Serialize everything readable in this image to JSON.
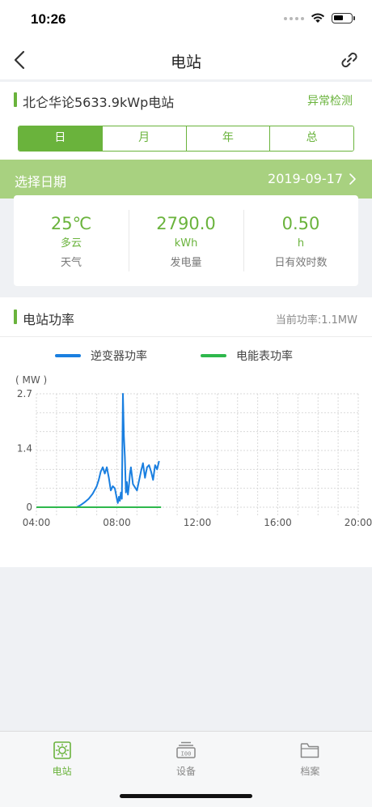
{
  "status_bar": {
    "time": "10:26"
  },
  "nav": {
    "title": "电站"
  },
  "station": {
    "name": "北仑华论5633.9kWp电站",
    "anomaly_link": "异常检测"
  },
  "period_tabs": [
    "日",
    "月",
    "年",
    "总"
  ],
  "active_period": "日",
  "date_bar": {
    "label": "选择日期",
    "value": "2019-09-17"
  },
  "stats": [
    {
      "value": "25℃",
      "unit": "多云",
      "label": "天气"
    },
    {
      "value": "2790.0",
      "unit": "kWh",
      "label": "发电量"
    },
    {
      "value": "0.50",
      "unit": "h",
      "label": "日有效时数"
    }
  ],
  "power": {
    "title": "电站功率",
    "current": "当前功率:1.1MW"
  },
  "colors": {
    "accent": "#6ab33c",
    "inverter_series": "#1a7fe0",
    "meter_series": "#2eb84c"
  },
  "chart_data": {
    "type": "line",
    "ylabel": "( MW )",
    "ylim": [
      0,
      2.7
    ],
    "y_ticks": [
      "2.7",
      "1.4",
      "0"
    ],
    "x_ticks": [
      "04:00",
      "08:00",
      "12:00",
      "16:00",
      "20:00"
    ],
    "xlim_hours": [
      4,
      20
    ],
    "grid": true,
    "legend_placement": "top",
    "series": [
      {
        "name": "逆变器功率",
        "color": "#1a7fe0",
        "points": [
          [
            6.0,
            0.0
          ],
          [
            6.2,
            0.05
          ],
          [
            6.4,
            0.12
          ],
          [
            6.6,
            0.2
          ],
          [
            6.8,
            0.32
          ],
          [
            7.0,
            0.5
          ],
          [
            7.1,
            0.65
          ],
          [
            7.2,
            0.85
          ],
          [
            7.3,
            0.95
          ],
          [
            7.4,
            0.8
          ],
          [
            7.5,
            0.95
          ],
          [
            7.6,
            0.7
          ],
          [
            7.7,
            0.4
          ],
          [
            7.8,
            0.5
          ],
          [
            7.9,
            0.45
          ],
          [
            8.0,
            0.2
          ],
          [
            8.05,
            0.1
          ],
          [
            8.1,
            0.25
          ],
          [
            8.15,
            0.15
          ],
          [
            8.2,
            0.35
          ],
          [
            8.25,
            0.2
          ],
          [
            8.3,
            2.7
          ],
          [
            8.35,
            1.7
          ],
          [
            8.4,
            1.2
          ],
          [
            8.45,
            0.35
          ],
          [
            8.5,
            0.6
          ],
          [
            8.55,
            0.3
          ],
          [
            8.6,
            0.5
          ],
          [
            8.65,
            0.8
          ],
          [
            8.7,
            0.95
          ],
          [
            8.8,
            0.55
          ],
          [
            9.0,
            0.4
          ],
          [
            9.2,
            0.85
          ],
          [
            9.3,
            1.05
          ],
          [
            9.4,
            0.7
          ],
          [
            9.5,
            0.95
          ],
          [
            9.6,
            1.0
          ],
          [
            9.7,
            0.85
          ],
          [
            9.8,
            0.65
          ],
          [
            9.9,
            1.0
          ],
          [
            10.0,
            0.9
          ],
          [
            10.1,
            1.1
          ]
        ]
      },
      {
        "name": "电能表功率",
        "color": "#2eb84c",
        "points": [
          [
            4.0,
            0.0
          ],
          [
            10.2,
            0.0
          ]
        ]
      }
    ]
  },
  "tabs": [
    {
      "label": "电站",
      "icon": "sun-icon",
      "active": true
    },
    {
      "label": "设备",
      "icon": "device-icon",
      "active": false
    },
    {
      "label": "档案",
      "icon": "folder-icon",
      "active": false
    }
  ]
}
